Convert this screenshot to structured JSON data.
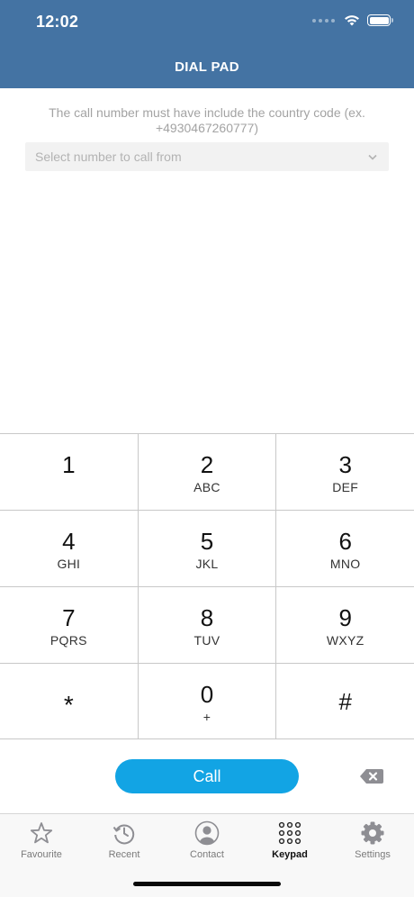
{
  "status": {
    "time": "12:02"
  },
  "header": {
    "title": "DIAL PAD"
  },
  "hint": {
    "text": "The call number must have include the country code (ex. +4930467260777)"
  },
  "select": {
    "placeholder": "Select number to call from"
  },
  "keypad": {
    "rows": [
      [
        {
          "num": "1",
          "letters": ""
        },
        {
          "num": "2",
          "letters": "ABC"
        },
        {
          "num": "3",
          "letters": "DEF"
        }
      ],
      [
        {
          "num": "4",
          "letters": "GHI"
        },
        {
          "num": "5",
          "letters": "JKL"
        },
        {
          "num": "6",
          "letters": "MNO"
        }
      ],
      [
        {
          "num": "7",
          "letters": "PQRS"
        },
        {
          "num": "8",
          "letters": "TUV"
        },
        {
          "num": "9",
          "letters": "WXYZ"
        }
      ],
      [
        {
          "num": "*",
          "letters": ""
        },
        {
          "num": "0",
          "letters": "+"
        },
        {
          "num": "#",
          "letters": ""
        }
      ]
    ]
  },
  "call": {
    "label": "Call"
  },
  "tabbar": {
    "items": [
      {
        "label": "Favourite",
        "icon": "star-icon"
      },
      {
        "label": "Recent",
        "icon": "history-icon"
      },
      {
        "label": "Contact",
        "icon": "person-icon"
      },
      {
        "label": "Keypad",
        "icon": "keypad-icon",
        "active": true
      },
      {
        "label": "Settings",
        "icon": "gear-icon"
      }
    ]
  },
  "colors": {
    "header": "#4473a3",
    "call_button": "#12a4e4"
  }
}
